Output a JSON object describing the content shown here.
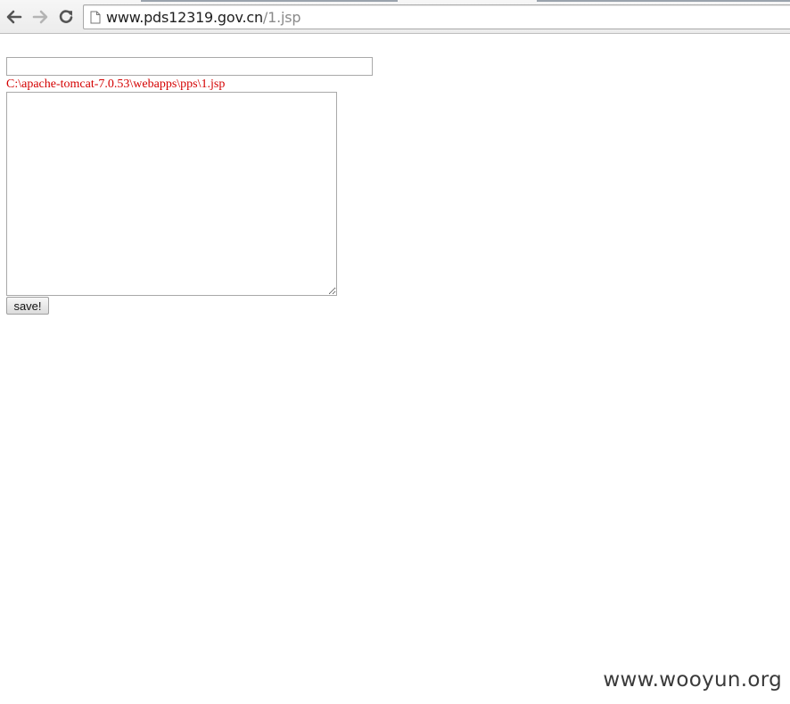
{
  "browser": {
    "back_icon": "arrow-left-icon",
    "forward_icon": "arrow-right-icon",
    "reload_icon": "reload-icon",
    "page_icon": "document-icon",
    "url_host": "www.pds12319.gov.cn",
    "url_path": "/1.jsp"
  },
  "form": {
    "path_input_value": "",
    "file_path": "C:\\apache-tomcat-7.0.53\\webapps\\pps\\1.jsp",
    "file_path_color": "#d40000",
    "content_value": "",
    "save_label": "save!"
  },
  "watermark": {
    "text": "www.wooyun.org"
  }
}
